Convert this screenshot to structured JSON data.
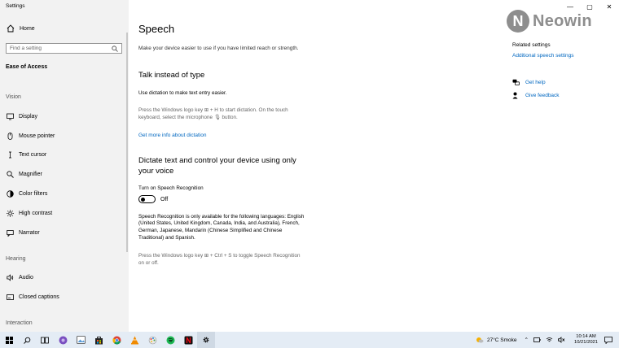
{
  "window": {
    "title": "Settings"
  },
  "sidebar": {
    "home": "Home",
    "search_placeholder": "Find a setting",
    "category": "Ease of Access",
    "groups": {
      "vision": "Vision",
      "hearing": "Hearing",
      "interaction": "Interaction"
    },
    "items": [
      {
        "label": "Display",
        "icon": "display-icon"
      },
      {
        "label": "Mouse pointer",
        "icon": "mouse-pointer-icon"
      },
      {
        "label": "Text cursor",
        "icon": "text-cursor-icon"
      },
      {
        "label": "Magnifier",
        "icon": "magnifier-icon"
      },
      {
        "label": "Color filters",
        "icon": "color-filters-icon"
      },
      {
        "label": "High contrast",
        "icon": "high-contrast-icon"
      },
      {
        "label": "Narrator",
        "icon": "narrator-icon"
      },
      {
        "label": "Audio",
        "icon": "audio-icon"
      },
      {
        "label": "Closed captions",
        "icon": "closed-captions-icon"
      }
    ]
  },
  "main": {
    "title": "Speech",
    "subtitle": "Make your device easier to use if you have limited reach or strength.",
    "talk": {
      "heading": "Talk instead of type",
      "desc": "Use dictation to make text entry easier.",
      "hint_line1": "Press the Windows logo key ⊞ + H to start dictation.  On the touch",
      "hint_line2": "keyboard, select the microphone 🎙 button.",
      "link": "Get more info about dictation"
    },
    "dictate": {
      "heading_line1": "Dictate text and control your device using only",
      "heading_line2": "your voice",
      "toggle_title": "Turn on Speech Recognition",
      "toggle_state": "Off",
      "info": [
        "Speech Recognition is only available for the following languages: English",
        "(United States, United Kingdom, Canada, India, and Australia), French,",
        "German, Japanese, Mandarin (Chinese Simplified and Chinese",
        "Traditional) and Spanish."
      ],
      "hint_line1": "Press the Windows logo key ⊞ + Ctrl + S to toggle Speech Recognition",
      "hint_line2": "on or off."
    }
  },
  "right": {
    "logo_text": "Neowin",
    "related_title": "Related settings",
    "related_link": "Additional speech settings",
    "get_help": "Get help",
    "give_feedback": "Give feedback"
  },
  "taskbar": {
    "weather": "27°C  Smoke",
    "time": "10:14 AM",
    "date": "10/21/2021",
    "accent": "#0067c0"
  }
}
